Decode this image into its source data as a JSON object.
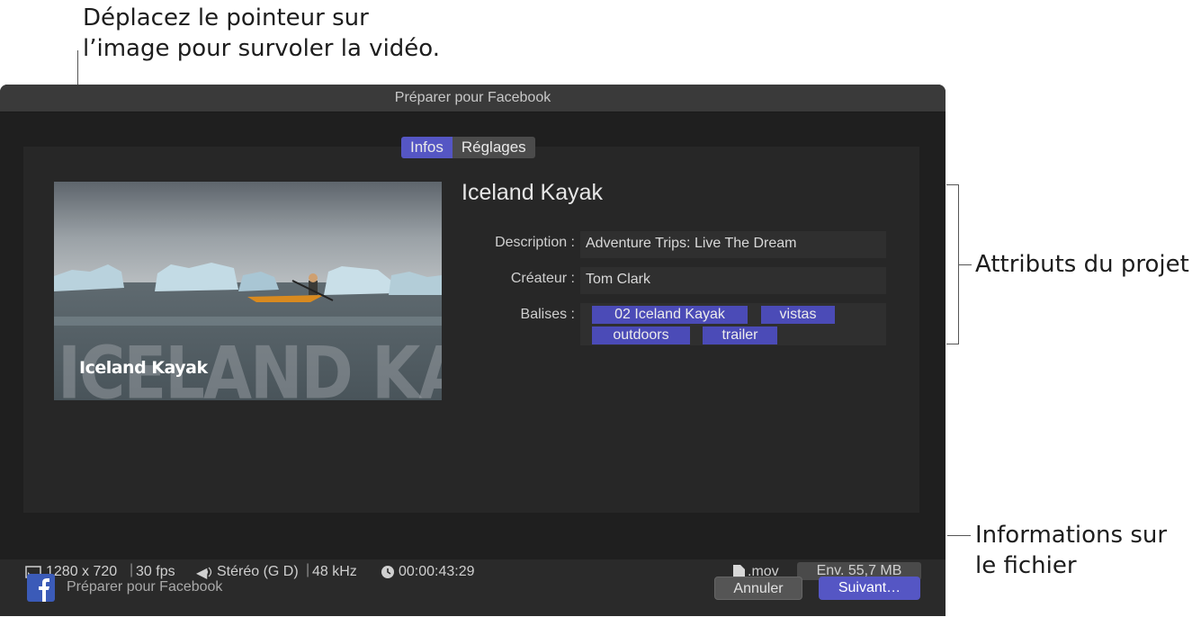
{
  "callouts": {
    "top_line1": "Déplacez le pointeur sur",
    "top_line2": "l’image pour survoler la vidéo.",
    "right_attrs": "Attributs du projet",
    "right_file_line1": "Informations sur",
    "right_file_line2": "le fichier"
  },
  "window": {
    "title": "Préparer pour Facebook",
    "tabs": [
      {
        "label": "Infos",
        "selected": true
      },
      {
        "label": "Réglages",
        "selected": false
      }
    ]
  },
  "thumbnail": {
    "big_title": "ICELAND KAYAK",
    "small_title": "Iceland Kayak"
  },
  "project": {
    "title": "Iceland Kayak",
    "description_label": "Description :",
    "description_value": "Adventure Trips: Live The Dream",
    "creator_label": "Créateur :",
    "creator_value": "Tom Clark",
    "tags_label": "Balises :",
    "tags": [
      "02 Iceland Kayak",
      "vistas",
      "outdoors",
      "trailer"
    ]
  },
  "file_info": {
    "resolution": "1280 x 720",
    "fps": "30 fps",
    "audio": "Stéréo (G D)",
    "sample_rate": "48 kHz",
    "duration": "00:00:43:29",
    "extension": ".mov",
    "size": "Env. 55,7 MB"
  },
  "footer": {
    "share_label": "Préparer pour Facebook",
    "cancel_label": "Annuler",
    "next_label": "Suivant…"
  },
  "colors": {
    "accent": "#5556c4",
    "tag_bg": "#4b4bb7",
    "window_bg": "#2a2a2a"
  },
  "icons": [
    "display-icon",
    "speaker-icon",
    "clock-icon",
    "document-icon",
    "facebook-icon"
  ]
}
